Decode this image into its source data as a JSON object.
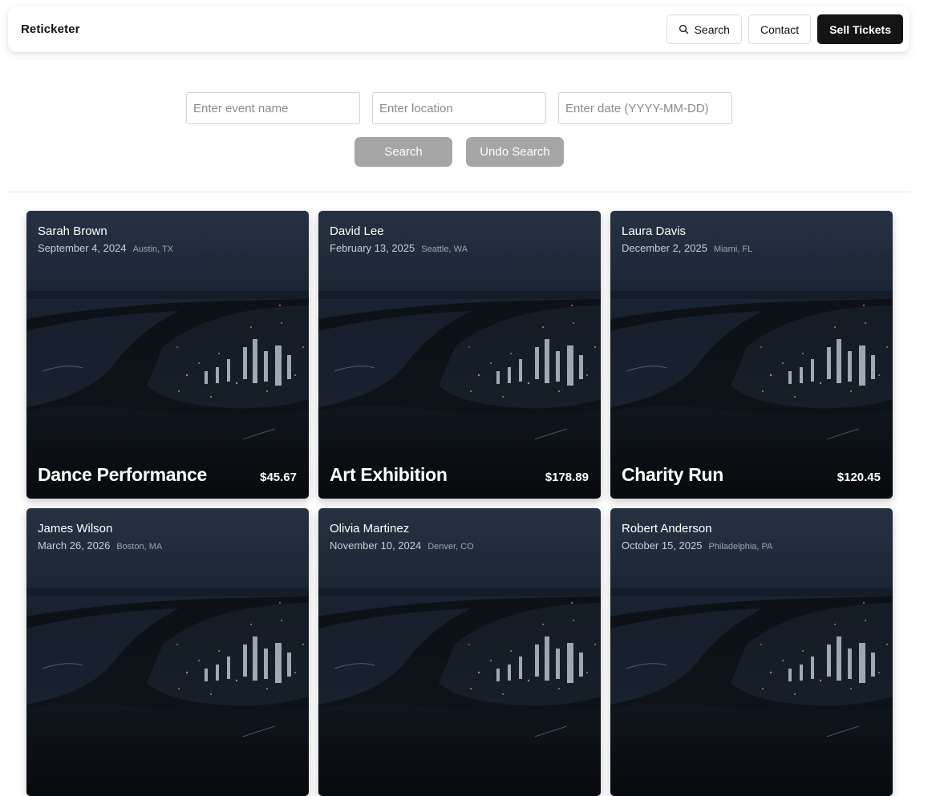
{
  "brand": "Reticketer",
  "nav": {
    "search_label": "Search",
    "search_icon": "search-icon",
    "contact_label": "Contact",
    "sell_label": "Sell Tickets"
  },
  "filters": {
    "event_placeholder": "Enter event name",
    "location_placeholder": "Enter location",
    "date_placeholder": "Enter date (YYYY-MM-DD)",
    "search_button": "Search",
    "undo_button": "Undo Search"
  },
  "colors": {
    "primary_button": "#141414",
    "secondary_button": "#a6a6a6"
  },
  "events": [
    {
      "organizer": "Sarah Brown",
      "date": "September 4, 2024",
      "location": "Austin, TX",
      "title": "Dance Performance",
      "price": "$45.67"
    },
    {
      "organizer": "David Lee",
      "date": "February 13, 2025",
      "location": "Seattle, WA",
      "title": "Art Exhibition",
      "price": "$178.89"
    },
    {
      "organizer": "Laura Davis",
      "date": "December 2, 2025",
      "location": "Miami, FL",
      "title": "Charity Run",
      "price": "$120.45"
    },
    {
      "organizer": "James Wilson",
      "date": "March 26, 2026",
      "location": "Boston, MA",
      "title": "",
      "price": ""
    },
    {
      "organizer": "Olivia Martinez",
      "date": "November 10, 2024",
      "location": "Denver, CO",
      "title": "",
      "price": ""
    },
    {
      "organizer": "Robert Anderson",
      "date": "October 15, 2025",
      "location": "Philadelphia, PA",
      "title": "",
      "price": ""
    }
  ]
}
